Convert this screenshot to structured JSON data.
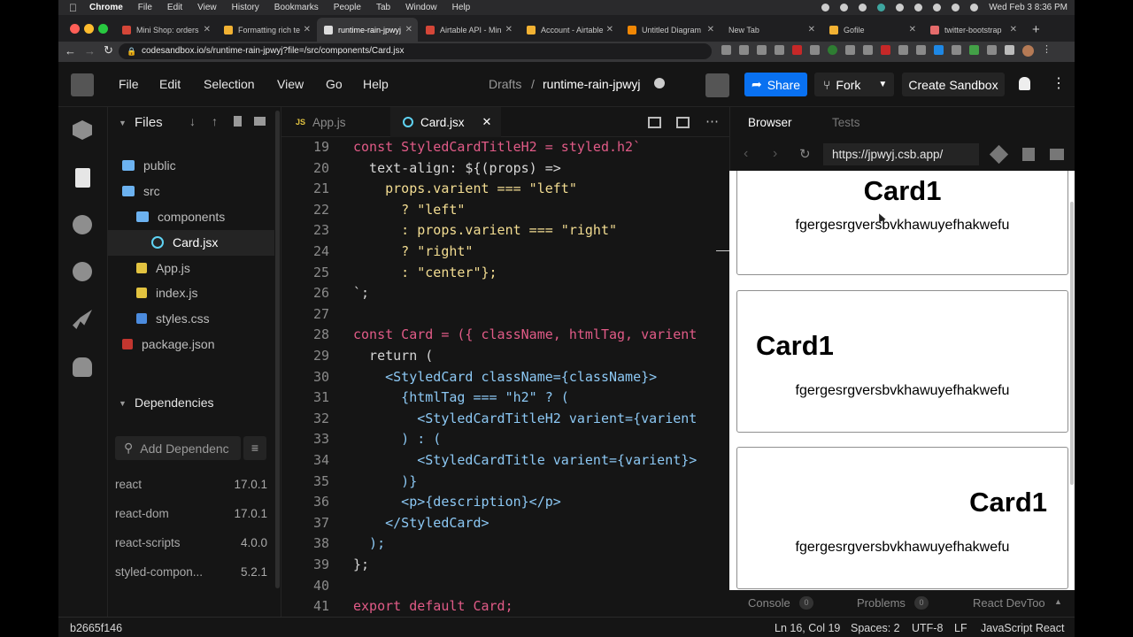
{
  "mac_menubar": {
    "app": "Chrome",
    "items": [
      "File",
      "Edit",
      "View",
      "History",
      "Bookmarks",
      "People",
      "Tab",
      "Window",
      "Help"
    ],
    "clock": "Wed Feb 3  8:36 PM"
  },
  "browser_tabs": [
    {
      "label": "Mini Shop: orders",
      "color": "#d44638"
    },
    {
      "label": "Formatting rich te",
      "color": "#f2b233"
    },
    {
      "label": "runtime-rain-jpwyj",
      "color": "#dddddd",
      "active": true
    },
    {
      "label": "Airtable API - Min",
      "color": "#d44638"
    },
    {
      "label": "Account - Airtable",
      "color": "#f2b233"
    },
    {
      "label": "Untitled Diagram",
      "color": "#f08705"
    },
    {
      "label": "New Tab",
      "color": ""
    },
    {
      "label": "Gofile",
      "color": "#f2b233"
    },
    {
      "label": "twitter-bootstrap",
      "color": "#e56b6b"
    }
  ],
  "url": "codesandbox.io/s/runtime-rain-jpwyj?file=/src/components/Card.jsx",
  "csb": {
    "menu": [
      "File",
      "Edit",
      "Selection",
      "View",
      "Go",
      "Help"
    ],
    "breadcrumb_folder": "Drafts",
    "breadcrumb_sep": "/",
    "sandbox_name": "runtime-rain-jpwyj",
    "share_label": "Share",
    "fork_label": "Fork",
    "create_label": "Create Sandbox"
  },
  "sidebar": {
    "files_title": "Files",
    "tree": [
      {
        "label": "public",
        "type": "folder",
        "depth": 0
      },
      {
        "label": "src",
        "type": "folder",
        "depth": 0
      },
      {
        "label": "components",
        "type": "folder",
        "depth": 1
      },
      {
        "label": "Card.jsx",
        "type": "react",
        "depth": 2,
        "selected": true
      },
      {
        "label": "App.js",
        "type": "js",
        "depth": 1
      },
      {
        "label": "index.js",
        "type": "js",
        "depth": 1
      },
      {
        "label": "styles.css",
        "type": "css",
        "depth": 1
      },
      {
        "label": "package.json",
        "type": "json",
        "depth": 0
      }
    ],
    "deps_title": "Dependencies",
    "add_dep_placeholder": "Add Dependenc",
    "deps": [
      {
        "name": "react",
        "version": "17.0.1"
      },
      {
        "name": "react-dom",
        "version": "17.0.1"
      },
      {
        "name": "react-scripts",
        "version": "4.0.0"
      },
      {
        "name": "styled-compon...",
        "version": "5.2.1"
      }
    ]
  },
  "editor": {
    "tabs": [
      {
        "label": "App.js",
        "badge": "JS"
      },
      {
        "label": "Card.jsx",
        "active": true
      }
    ],
    "line_numbers": [
      "19",
      "20",
      "21",
      "22",
      "23",
      "24",
      "25",
      "26",
      "27",
      "28",
      "29",
      "30",
      "31",
      "32",
      "33",
      "34",
      "35",
      "36",
      "37",
      "38",
      "39",
      "40",
      "41"
    ],
    "lines": [
      "const StyledCardTitleH2 = styled.h2`",
      "  text-align: ${(props) =>",
      "    props.varient === \"left\"",
      "      ? \"left\"",
      "      : props.varient === \"right\"",
      "      ? \"right\"",
      "      : \"center\"};",
      "`;",
      "",
      "const Card = ({ className, htmlTag, varient",
      "  return (",
      "    <StyledCard className={className}>",
      "      {htmlTag === \"h2\" ? (",
      "        <StyledCardTitleH2 varient={varient",
      "      ) : (",
      "        <StyledCardTitle varient={varient}>",
      "      )}",
      "      <p>{description}</p>",
      "    </StyledCard>",
      "  );",
      "};",
      "",
      "export default Card;"
    ]
  },
  "preview": {
    "tab_browser": "Browser",
    "tab_tests": "Tests",
    "url": "https://jpwyj.csb.app/",
    "cards": [
      {
        "title": "Card1",
        "align": "center",
        "text": "fgergesrgversbvkhawuyefhakwefu"
      },
      {
        "title": "Card1",
        "align": "left",
        "text": "fgergesrgversbvkhawuyefhakwefu"
      },
      {
        "title": "Card1",
        "align": "right",
        "text": "fgergesrgversbvkhawuyefhakwefu"
      }
    ],
    "bottom_tabs": [
      {
        "label": "Console",
        "count": "0"
      },
      {
        "label": "Problems",
        "count": "0"
      },
      {
        "label": "React DevToo",
        "count": ""
      }
    ]
  },
  "status": {
    "hash": "b2665f146",
    "position": "Ln 16, Col 19",
    "spaces": "Spaces: 2",
    "encoding": "UTF-8",
    "eol": "LF",
    "language": "JavaScript React"
  },
  "colors": {
    "accent": "#0971f1",
    "editor_bg": "#151515"
  }
}
